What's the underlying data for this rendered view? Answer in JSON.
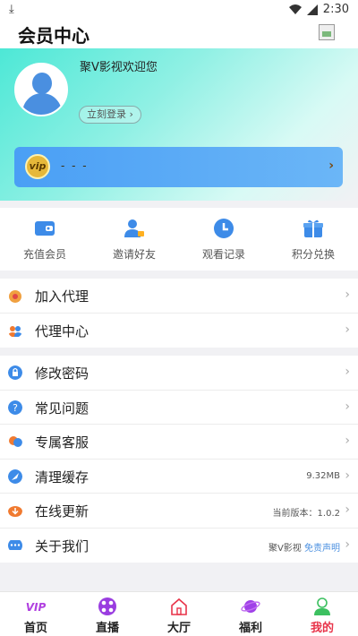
{
  "status_bar": {
    "time": "2:30"
  },
  "header": {
    "title": "会员中心"
  },
  "profile": {
    "welcome": "聚V影视欢迎您",
    "login_label": "立刻登录",
    "vip_badge": "vip",
    "vip_text": "- - -"
  },
  "quick_actions": [
    {
      "label": "充值会员",
      "icon": "wallet-icon"
    },
    {
      "label": "邀请好友",
      "icon": "invite-user-icon"
    },
    {
      "label": "观看记录",
      "icon": "clock-icon"
    },
    {
      "label": "积分兑换",
      "icon": "gift-icon"
    }
  ],
  "agent_menu": [
    {
      "label": "加入代理",
      "icon": "medal-icon"
    },
    {
      "label": "代理中心",
      "icon": "users-icon"
    }
  ],
  "settings_menu": [
    {
      "label": "修改密码",
      "icon": "lock-icon",
      "extra": ""
    },
    {
      "label": "常见问题",
      "icon": "question-icon",
      "extra": ""
    },
    {
      "label": "专属客服",
      "icon": "chat-bubbles-icon",
      "extra": ""
    },
    {
      "label": "清理缓存",
      "icon": "rocket-icon",
      "extra": "9.32MB"
    },
    {
      "label": "在线更新",
      "icon": "cloud-download-icon",
      "extra": "当前版本：1.0.2"
    },
    {
      "label": "关于我们",
      "icon": "message-dots-icon",
      "extra": "聚V影视",
      "extra_link": "免责声明"
    }
  ],
  "tabs": [
    {
      "label": "首页",
      "icon": "vip-logo-icon"
    },
    {
      "label": "直播",
      "icon": "film-reel-icon"
    },
    {
      "label": "大厅",
      "icon": "house-icon"
    },
    {
      "label": "福利",
      "icon": "planet-icon"
    },
    {
      "label": "我的",
      "icon": "person-icon",
      "active": true
    }
  ],
  "colors": {
    "accent": "#e8344a",
    "vip_card": "#4a9ff5",
    "hero": "#4de8d6",
    "link": "#4a8fe0"
  }
}
